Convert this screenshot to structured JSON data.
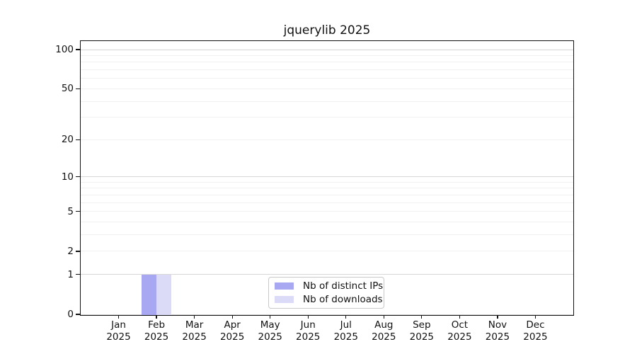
{
  "chart_data": {
    "type": "bar",
    "title": "jquerylib 2025",
    "x_categories": [
      "Jan",
      "Feb",
      "Mar",
      "Apr",
      "May",
      "Jun",
      "Jul",
      "Aug",
      "Sep",
      "Oct",
      "Nov",
      "Dec"
    ],
    "x_year": "2025",
    "series": [
      {
        "name": "Nb of distinct IPs",
        "color": "#a7a7f2",
        "values": [
          0,
          1,
          0,
          0,
          0,
          0,
          0,
          0,
          0,
          0,
          0,
          0
        ]
      },
      {
        "name": "Nb of downloads",
        "color": "#dbdbf8",
        "values": [
          0,
          1,
          0,
          0,
          0,
          0,
          0,
          0,
          0,
          0,
          0,
          0
        ]
      }
    ],
    "y_axis": {
      "scale": "log1p",
      "tick_values": [
        0,
        1,
        2,
        5,
        10,
        20,
        50,
        100
      ],
      "tick_labels": [
        "0",
        "1",
        "2",
        "5",
        "10",
        "20",
        "50",
        "100"
      ],
      "major_grid_values": [
        0,
        1,
        10,
        100
      ],
      "minor_grid_values": [
        2,
        3,
        4,
        5,
        6,
        7,
        8,
        9,
        20,
        30,
        40,
        50,
        60,
        70,
        80,
        90
      ],
      "range_top": 100
    },
    "legend_position": "lower center",
    "grid": true,
    "colors": {
      "grid_major": "#d7d7d7",
      "grid_minor": "#f0f0f0",
      "axis": "#111111",
      "legend_border": "#c9c9c9",
      "background": "#ffffff"
    }
  }
}
